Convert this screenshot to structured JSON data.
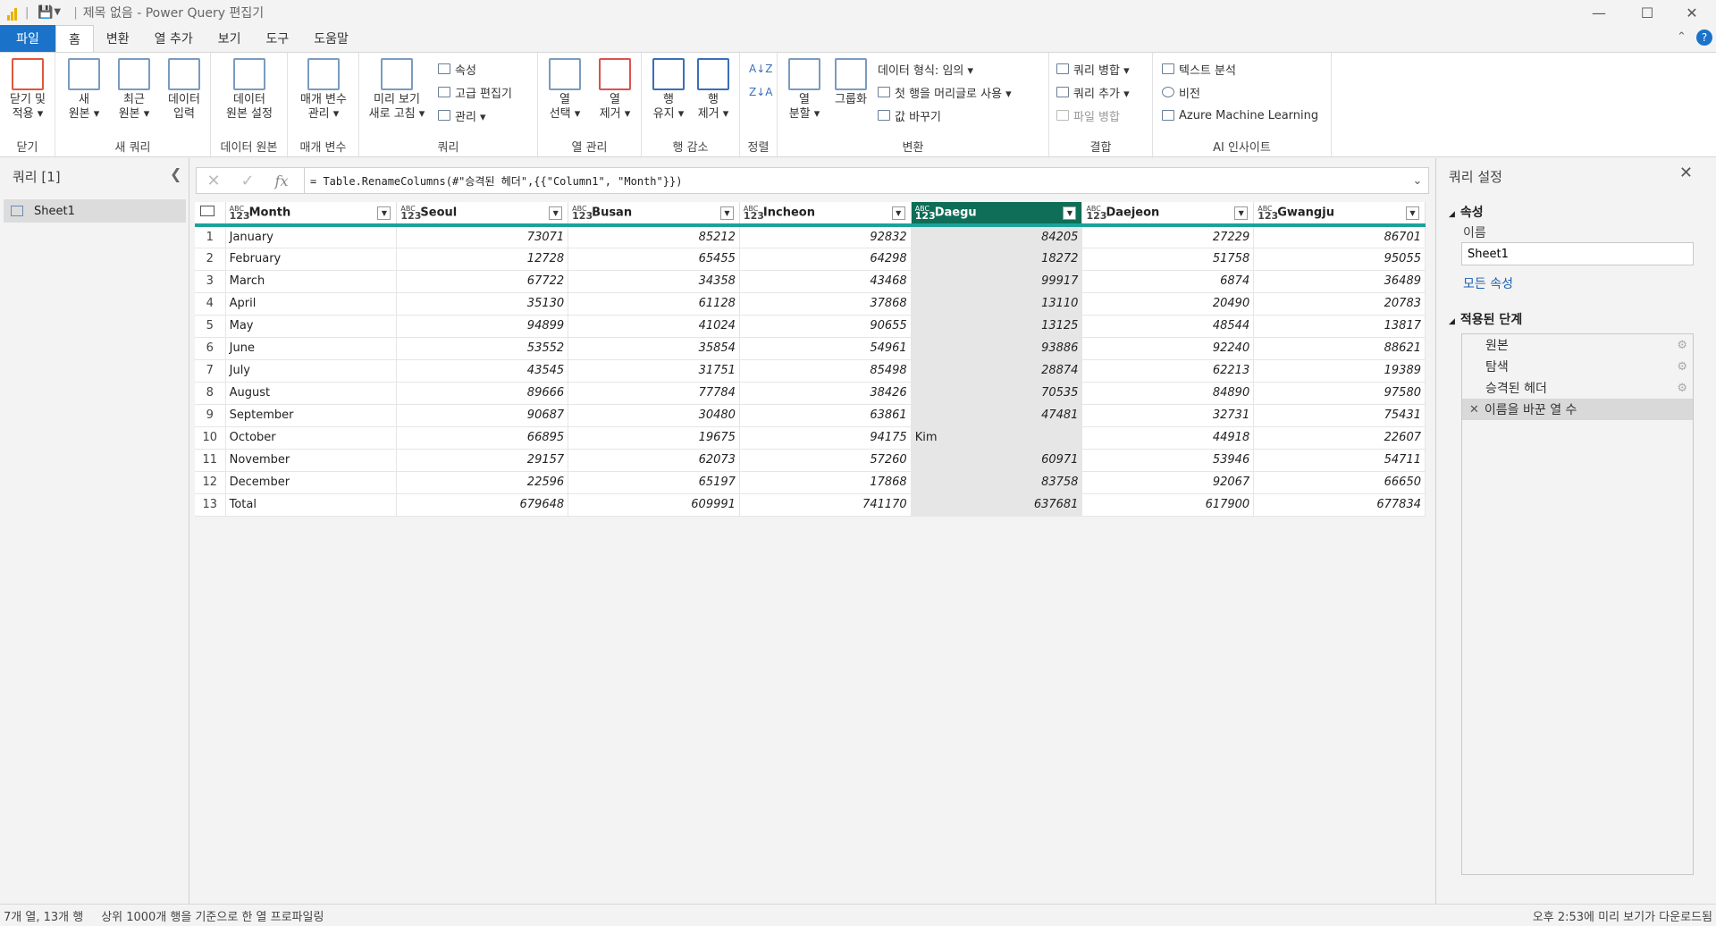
{
  "window": {
    "title": "제목 없음 - Power Query 편집기"
  },
  "tabs": [
    "파일",
    "홈",
    "변환",
    "열 추가",
    "보기",
    "도구",
    "도움말"
  ],
  "ribbon": {
    "groups": {
      "close": "닫기",
      "new_query": "새 쿼리",
      "data_source": "데이터 원본",
      "params": "매개 변수",
      "query": "쿼리",
      "manage_cols": "열 관리",
      "reduce_rows": "행 감소",
      "sort": "정렬",
      "transform": "변환",
      "combine": "결합",
      "ai": "AI 인사이트"
    },
    "buttons": {
      "close_apply": "닫기 및\n적용 ▾",
      "new_source": "새\n원본 ▾",
      "recent_source": "최근\n원본 ▾",
      "enter_data": "데이터\n입력",
      "ds_settings": "데이터\n원본 설정",
      "manage_params": "매개 변수\n관리 ▾",
      "refresh_preview": "미리 보기\n새로 고침 ▾",
      "properties": "속성",
      "advanced_editor": "고급 편집기",
      "manage": "관리 ▾",
      "choose_cols": "열\n선택 ▾",
      "remove_cols": "열\n제거 ▾",
      "keep_rows": "행\n유지 ▾",
      "remove_rows": "행\n제거 ▾",
      "split_col": "열\n분할 ▾",
      "group_by": "그룹화",
      "data_type": "데이터 형식: 임의 ▾",
      "first_row_header": "첫 행을 머리글로 사용 ▾",
      "replace_values": "값 바꾸기",
      "merge_queries": "쿼리 병합 ▾",
      "append_queries": "쿼리 추가 ▾",
      "combine_files": "파일 병합",
      "text_analytics": "텍스트 분석",
      "vision": "비전",
      "azure_ml": "Azure Machine Learning"
    }
  },
  "left_pane": {
    "title": "쿼리 [1]",
    "items": [
      "Sheet1"
    ]
  },
  "formula_bar": {
    "formula": "= Table.RenameColumns(#\"승격된 헤더\",{{\"Column1\", \"Month\"}})"
  },
  "table": {
    "type_label": "ABC\n123",
    "columns": [
      "Month",
      "Seoul",
      "Busan",
      "Incheon",
      "Daegu",
      "Daejeon",
      "Gwangju"
    ],
    "selected_column": 4,
    "rows": [
      [
        "1",
        "January",
        "73071",
        "85212",
        "92832",
        "84205",
        "27229",
        "86701"
      ],
      [
        "2",
        "February",
        "12728",
        "65455",
        "64298",
        "18272",
        "51758",
        "95055"
      ],
      [
        "3",
        "March",
        "67722",
        "34358",
        "43468",
        "99917",
        "6874",
        "36489"
      ],
      [
        "4",
        "April",
        "35130",
        "61128",
        "37868",
        "13110",
        "20490",
        "20783"
      ],
      [
        "5",
        "May",
        "94899",
        "41024",
        "90655",
        "13125",
        "48544",
        "13817"
      ],
      [
        "6",
        "June",
        "53552",
        "35854",
        "54961",
        "93886",
        "92240",
        "88621"
      ],
      [
        "7",
        "July",
        "43545",
        "31751",
        "85498",
        "28874",
        "62213",
        "19389"
      ],
      [
        "8",
        "August",
        "89666",
        "77784",
        "38426",
        "70535",
        "84890",
        "97580"
      ],
      [
        "9",
        "September",
        "90687",
        "30480",
        "63861",
        "47481",
        "32731",
        "75431"
      ],
      [
        "10",
        "October",
        "66895",
        "19675",
        "94175",
        "Kim",
        "44918",
        "22607"
      ],
      [
        "11",
        "November",
        "29157",
        "62073",
        "57260",
        "60971",
        "53946",
        "54711"
      ],
      [
        "12",
        "December",
        "22596",
        "65197",
        "17868",
        "83758",
        "92067",
        "66650"
      ],
      [
        "13",
        "Total",
        "679648",
        "609991",
        "741170",
        "637681",
        "617900",
        "677834"
      ]
    ]
  },
  "right_pane": {
    "title": "쿼리 설정",
    "properties_label": "속성",
    "name_label": "이름",
    "name_value": "Sheet1",
    "all_props_link": "모든 속성",
    "applied_steps_label": "적용된 단계",
    "steps": [
      "원본",
      "탐색",
      "승격된 헤더",
      "이름을 바꾼 열 수"
    ],
    "active_step": 3
  },
  "status": {
    "left": "7개 열, 13개 행",
    "profiling": "상위 1000개 행을 기준으로 한 열 프로파일링",
    "right": "오후 2:53에 미리 보기가 다운로드됨"
  }
}
